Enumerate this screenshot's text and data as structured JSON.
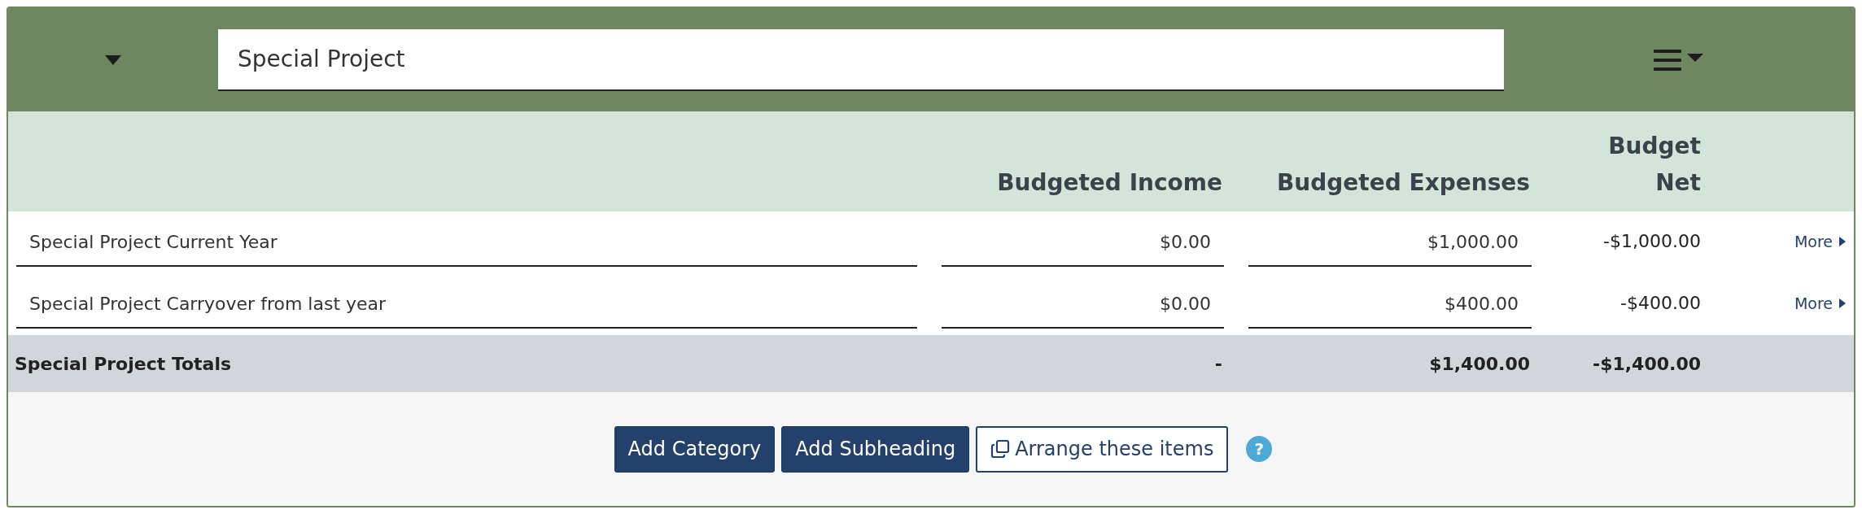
{
  "header": {
    "title_value": "Special Project"
  },
  "columns": [
    "Budgeted Income",
    "Budgeted Expenses",
    "Budget Net"
  ],
  "rows": [
    {
      "name": "Special Project Current Year",
      "income": "$0.00",
      "expenses": "$1,000.00",
      "net": "-$1,000.00",
      "more": "More"
    },
    {
      "name": "Special Project Carryover from last year",
      "income": "$0.00",
      "expenses": "$400.00",
      "net": "-$400.00",
      "more": "More"
    }
  ],
  "totals": {
    "label": "Special Project Totals",
    "income": "-",
    "expenses": "$1,400.00",
    "net": "-$1,400.00"
  },
  "buttons": [
    {
      "label": "Add Category",
      "kind": "primary"
    },
    {
      "label": "Add Subheading",
      "kind": "primary"
    },
    {
      "label": "Arrange these items",
      "kind": "outline"
    }
  ],
  "help": "?"
}
